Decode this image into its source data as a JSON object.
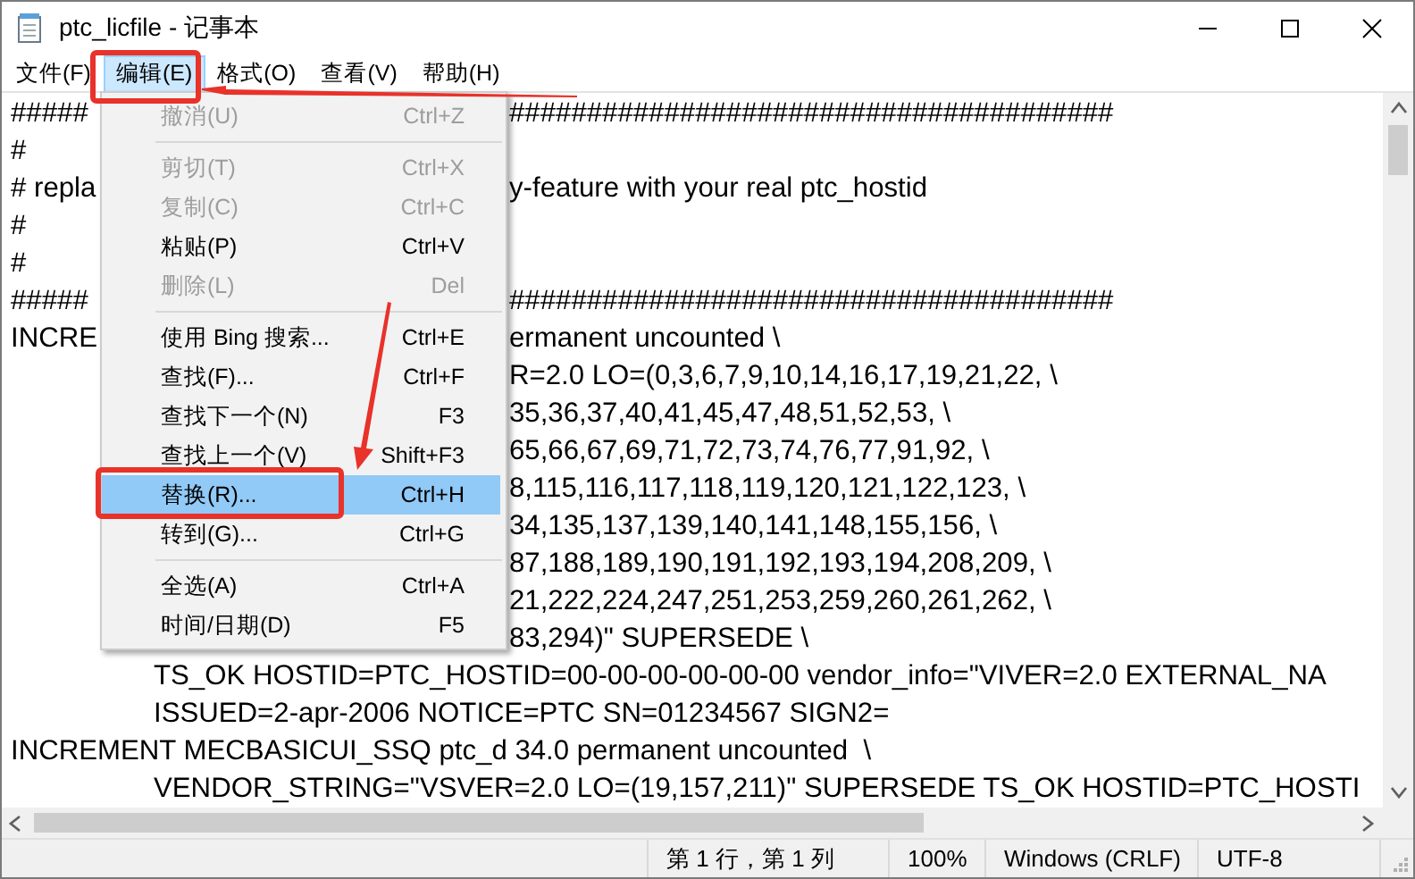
{
  "window": {
    "title": "ptc_licfile - 记事本"
  },
  "menu_bar": [
    {
      "label": "文件(F)",
      "selected": false
    },
    {
      "label": "编辑(E)",
      "selected": true
    },
    {
      "label": "格式(O)",
      "selected": false
    },
    {
      "label": "查看(V)",
      "selected": false
    },
    {
      "label": "帮助(H)",
      "selected": false
    }
  ],
  "dropdown": {
    "items": [
      {
        "kind": "item",
        "label": "撤消(U)",
        "shortcut": "Ctrl+Z",
        "disabled": true,
        "selected": false
      },
      {
        "kind": "separator"
      },
      {
        "kind": "item",
        "label": "剪切(T)",
        "shortcut": "Ctrl+X",
        "disabled": true,
        "selected": false
      },
      {
        "kind": "item",
        "label": "复制(C)",
        "shortcut": "Ctrl+C",
        "disabled": true,
        "selected": false
      },
      {
        "kind": "item",
        "label": "粘贴(P)",
        "shortcut": "Ctrl+V",
        "disabled": false,
        "selected": false
      },
      {
        "kind": "item",
        "label": "删除(L)",
        "shortcut": "Del",
        "disabled": true,
        "selected": false
      },
      {
        "kind": "separator"
      },
      {
        "kind": "item",
        "label": "使用 Bing 搜索...",
        "shortcut": "Ctrl+E",
        "disabled": false,
        "selected": false
      },
      {
        "kind": "item",
        "label": "查找(F)...",
        "shortcut": "Ctrl+F",
        "disabled": false,
        "selected": false
      },
      {
        "kind": "item",
        "label": "查找下一个(N)",
        "shortcut": "F3",
        "disabled": false,
        "selected": false
      },
      {
        "kind": "item",
        "label": "查找上一个(V)",
        "shortcut": "Shift+F3",
        "disabled": false,
        "selected": false
      },
      {
        "kind": "item",
        "label": "替换(R)...",
        "shortcut": "Ctrl+H",
        "disabled": false,
        "selected": true
      },
      {
        "kind": "item",
        "label": "转到(G)...",
        "shortcut": "Ctrl+G",
        "disabled": false,
        "selected": false
      },
      {
        "kind": "separator"
      },
      {
        "kind": "item",
        "label": "全选(A)",
        "shortcut": "Ctrl+A",
        "disabled": false,
        "selected": false
      },
      {
        "kind": "item",
        "label": "时间/日期(D)",
        "shortcut": "F5",
        "disabled": false,
        "selected": false
      }
    ]
  },
  "editor": {
    "lines": [
      {
        "kind": "split",
        "left": "#####",
        "right": "#######################################"
      },
      {
        "kind": "split",
        "left": "#"
      },
      {
        "kind": "split",
        "left": "# repla",
        "right": "y-feature with your real ptc_hostid"
      },
      {
        "kind": "split",
        "left": "#"
      },
      {
        "kind": "split",
        "left": "#"
      },
      {
        "kind": "split",
        "left": "#####",
        "right": "#######################################"
      },
      {
        "kind": "split",
        "left": "INCRE",
        "right": "ermanent uncounted \\"
      },
      {
        "kind": "split",
        "right": "R=2.0 LO=(0,3,6,7,9,10,14,16,17,19,21,22, \\"
      },
      {
        "kind": "split",
        "right": "35,36,37,40,41,45,47,48,51,52,53, \\"
      },
      {
        "kind": "split",
        "right": "65,66,67,69,71,72,73,74,76,77,91,92, \\"
      },
      {
        "kind": "split",
        "right": "8,115,116,117,118,119,120,121,122,123, \\"
      },
      {
        "kind": "split",
        "right": "34,135,137,139,140,141,148,155,156, \\"
      },
      {
        "kind": "split",
        "right": "87,188,189,190,191,192,193,194,208,209, \\"
      },
      {
        "kind": "split",
        "right": "21,222,224,247,251,253,259,260,261,262, \\"
      },
      {
        "kind": "split",
        "right": "83,294)\" SUPERSEDE \\"
      },
      {
        "kind": "indented",
        "text": "TS_OK HOSTID=PTC_HOSTID=00-00-00-00-00-00 vendor_info=\"VIVER=2.0 EXTERNAL_NA"
      },
      {
        "kind": "indented",
        "text": "ISSUED=2-apr-2006 NOTICE=PTC SN=01234567 SIGN2="
      },
      {
        "kind": "plain",
        "text": "INCREMENT MECBASICUI_SSQ ptc_d 34.0 permanent uncounted  \\"
      },
      {
        "kind": "indented",
        "text": "VENDOR_STRING=\"VSVER=2.0 LO=(19,157,211)\" SUPERSEDE TS_OK HOSTID=PTC_HOSTI"
      }
    ]
  },
  "status_bar": [
    "第 1 行，第 1 列",
    "100%",
    "Windows (CRLF)",
    "UTF-8"
  ]
}
